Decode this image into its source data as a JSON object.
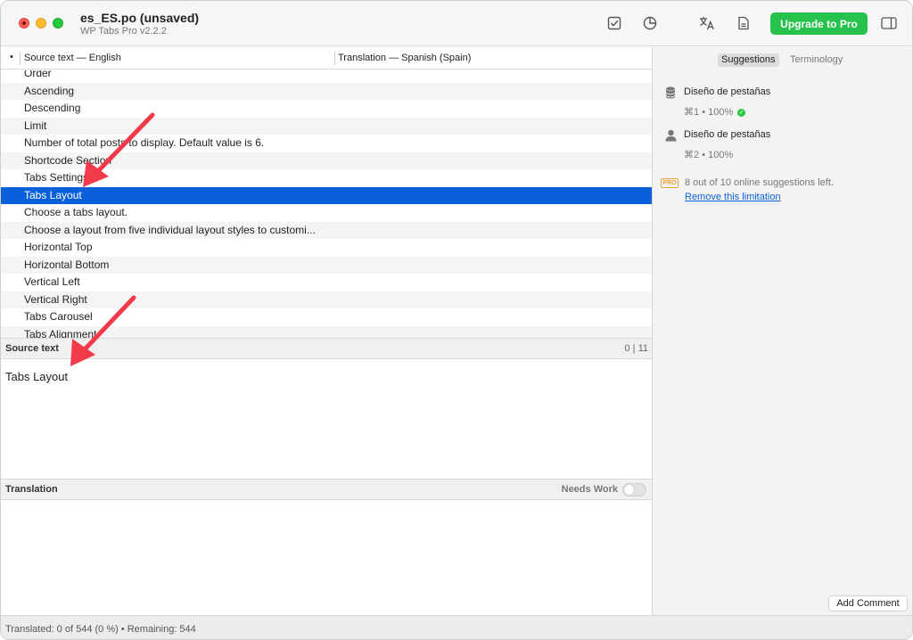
{
  "window": {
    "title": "es_ES.po (unsaved)",
    "subtitle": "WP Tabs Pro v2.2.2"
  },
  "toolbar": {
    "icons": [
      "checkmark-square-icon",
      "pie-chart-icon",
      "translate-icon",
      "document-icon",
      "sidebar-toggle-icon"
    ],
    "upgrade_label": "Upgrade to Pro",
    "accent_color": "#27c24c"
  },
  "columns": {
    "dot": "•",
    "source": "Source text — English",
    "translation": "Translation — Spanish (Spain)"
  },
  "list": {
    "rows": [
      "Order",
      "Ascending",
      "Descending",
      "Limit",
      "Number of total posts to display. Default value is 6.",
      "Shortcode Section",
      "Tabs Settings",
      "Tabs Layout",
      "Choose a tabs layout.",
      "Choose a layout from five individual layout styles to customi...",
      "Horizontal Top",
      "Horizontal Bottom",
      "Vertical Left",
      "Vertical Right",
      "Tabs Carousel",
      "Tabs Alignment"
    ],
    "selected_index": 7,
    "selection_color": "#0a60d9"
  },
  "source_section": {
    "label": "Source text",
    "count": "0 | 11",
    "text": "Tabs Layout"
  },
  "translation_section": {
    "label": "Translation",
    "needs_work_label": "Needs Work",
    "needs_work_on": false,
    "value": ""
  },
  "sidebar": {
    "tabs": [
      "Suggestions",
      "Terminology"
    ],
    "active_tab": "Suggestions",
    "suggestions": [
      {
        "icon": "database-icon",
        "text": "Diseño de pestañas",
        "shortcut": "⌘1",
        "score": "100%",
        "verified": true
      },
      {
        "icon": "person-icon",
        "text": "Diseño de pestañas",
        "shortcut": "⌘2",
        "score": "100%",
        "verified": false
      }
    ],
    "pro_badge": "PRO",
    "limit_text": "8 out of 10 online suggestions left.",
    "remove_link": "Remove this limitation",
    "add_comment": "Add Comment"
  },
  "status": {
    "text": "Translated: 0 of 544 (0 %)  •  Remaining: 544"
  },
  "annotations": {
    "arrow_color": "#f23a4a"
  }
}
